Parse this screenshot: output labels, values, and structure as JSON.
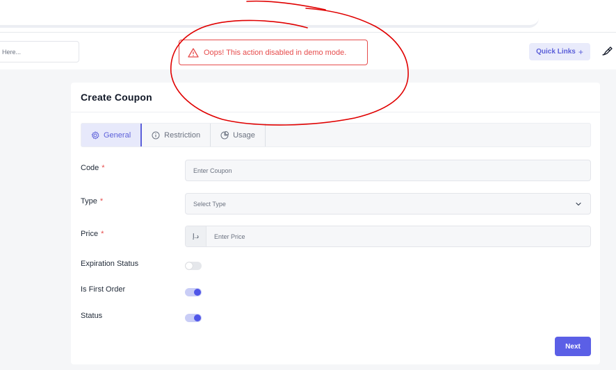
{
  "header": {
    "search_placeholder": "Here...",
    "alert_message": "Oops! This action disabled in demo mode.",
    "quick_links_label": "Quick Links",
    "quick_links_plus": "+"
  },
  "card": {
    "title": "Create Coupon",
    "tabs": [
      {
        "label": "General",
        "icon": "gear-icon",
        "active": true
      },
      {
        "label": "Restriction",
        "icon": "info-circle-icon",
        "active": false
      },
      {
        "label": "Usage",
        "icon": "pie-chart-icon",
        "active": false
      }
    ],
    "required_mark": "*",
    "fields": {
      "code": {
        "label": "Code",
        "placeholder": "Enter Coupon"
      },
      "type": {
        "label": "Type",
        "placeholder": "Select Type"
      },
      "price": {
        "label": "Price",
        "placeholder": "Enter Price",
        "currency": "د.إ"
      }
    },
    "toggles": [
      {
        "label": "Expiration Status",
        "on": false
      },
      {
        "label": "Is First Order",
        "on": true
      },
      {
        "label": "Status",
        "on": true
      }
    ],
    "next_label": "Next"
  },
  "colors": {
    "accent": "#5b5fe6",
    "alert": "#e64b4b",
    "annotation": "#e00000"
  }
}
